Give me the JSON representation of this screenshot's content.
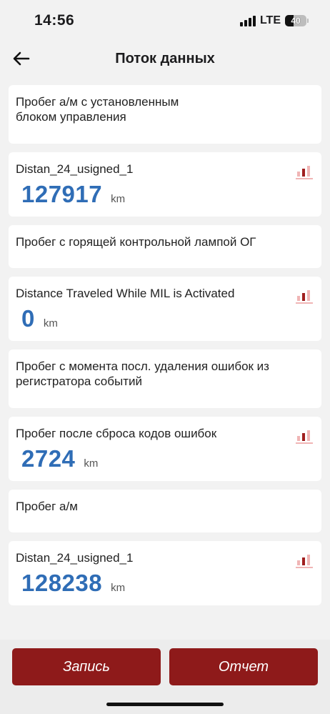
{
  "status": {
    "time": "14:56",
    "network": "LTE",
    "battery": "40"
  },
  "header": {
    "title": "Поток данных"
  },
  "items": [
    {
      "label": "Пробег а/м с установленным блоком управления",
      "value": null,
      "unit": null
    },
    {
      "label": "Distan_24_usigned_1",
      "value": "127917",
      "unit": "km"
    },
    {
      "label": "Пробег с горящей контрольной лампой ОГ",
      "value": null,
      "unit": null
    },
    {
      "label": "Distance Traveled While MIL is Activated",
      "value": "0",
      "unit": "km"
    },
    {
      "label": "Пробег с момента посл. удаления ошибок из регистратора событий",
      "value": null,
      "unit": null
    },
    {
      "label": "Пробег после сброса кодов ошибок",
      "value": "2724",
      "unit": "km"
    },
    {
      "label": "Пробег а/м",
      "value": null,
      "unit": null
    },
    {
      "label": "Distan_24_usigned_1",
      "value": "128238",
      "unit": "km"
    }
  ],
  "buttons": {
    "record": "Запись",
    "report": "Отчет"
  },
  "colors": {
    "accent": "#8e1a1a",
    "value": "#2f6db6",
    "chart_light": "#f0b5b5",
    "chart_dark": "#a01f1f"
  }
}
